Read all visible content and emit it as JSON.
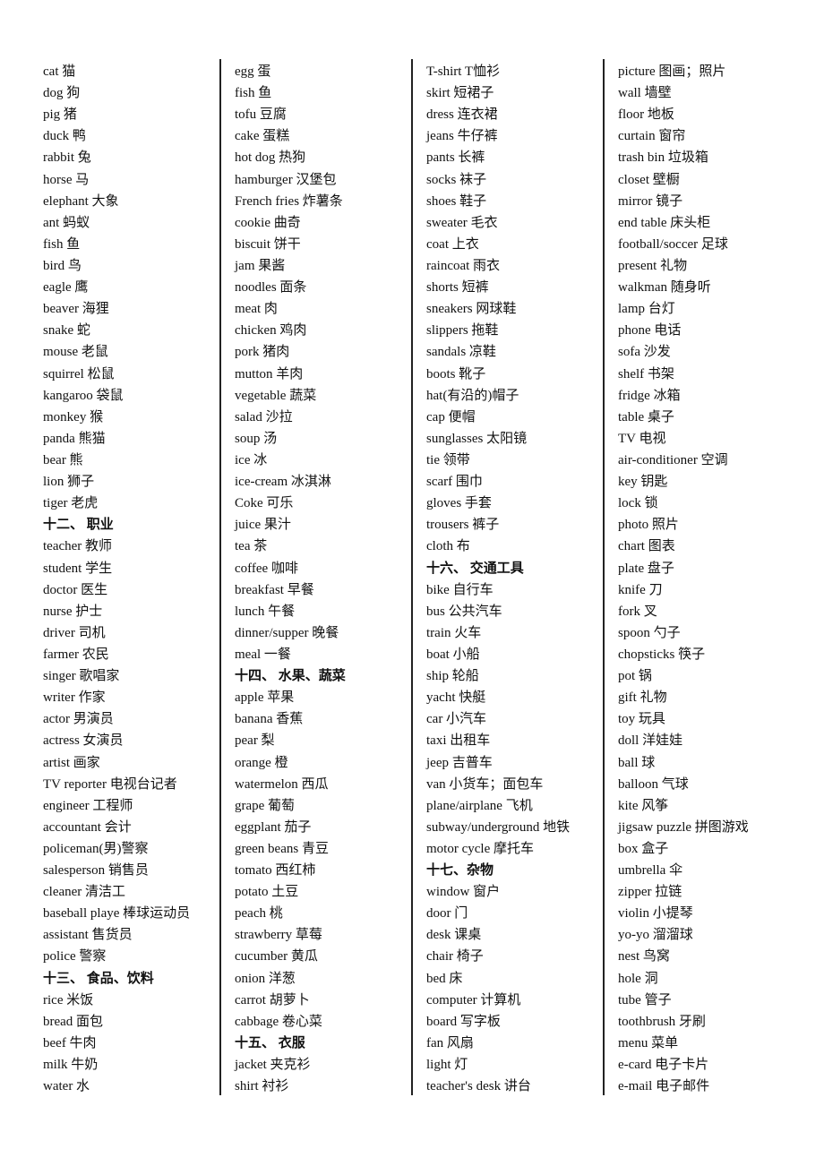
{
  "document": {
    "columns": [
      {
        "entries": [
          {
            "text": "cat 猫"
          },
          {
            "text": "dog 狗"
          },
          {
            "text": "pig 猪"
          },
          {
            "text": "duck 鸭"
          },
          {
            "text": "rabbit 兔"
          },
          {
            "text": "horse 马"
          },
          {
            "text": "elephant 大象"
          },
          {
            "text": "ant 蚂蚁"
          },
          {
            "text": "fish 鱼"
          },
          {
            "text": "bird 鸟"
          },
          {
            "text": "eagle 鹰"
          },
          {
            "text": "beaver 海狸"
          },
          {
            "text": "snake 蛇"
          },
          {
            "text": "mouse 老鼠"
          },
          {
            "text": "squirrel 松鼠"
          },
          {
            "text": "kangaroo 袋鼠"
          },
          {
            "text": "monkey 猴"
          },
          {
            "text": "panda 熊猫"
          },
          {
            "text": "bear 熊"
          },
          {
            "text": "lion 狮子"
          },
          {
            "text": "tiger  老虎"
          },
          {
            "text": "十二、  职业",
            "heading": true
          },
          {
            "text": "teacher 教师"
          },
          {
            "text": "student 学生"
          },
          {
            "text": "doctor 医生"
          },
          {
            "text": "nurse 护士"
          },
          {
            "text": "driver 司机"
          },
          {
            "text": "farmer 农民"
          },
          {
            "text": "singer 歌唱家"
          },
          {
            "text": "writer 作家"
          },
          {
            "text": "actor 男演员"
          },
          {
            "text": "actress 女演员"
          },
          {
            "text": "artist 画家"
          },
          {
            "text": "TV reporter 电视台记者"
          },
          {
            "text": "engineer 工程师"
          },
          {
            "text": "accountant 会计"
          },
          {
            "text": "policeman(男)警察"
          },
          {
            "text": "salesperson 销售员"
          },
          {
            "text": "cleaner 清洁工"
          },
          {
            "text": "baseball playe 棒球运动员"
          },
          {
            "text": "assistant 售货员"
          },
          {
            "text": "police 警察"
          },
          {
            "text": "十三、  食品、饮料",
            "heading": true
          },
          {
            "text": "rice 米饭"
          },
          {
            "text": "bread 面包"
          },
          {
            "text": "beef 牛肉"
          },
          {
            "text": "milk 牛奶"
          },
          {
            "text": "water 水"
          }
        ]
      },
      {
        "entries": [
          {
            "text": "egg 蛋"
          },
          {
            "text": "fish 鱼"
          },
          {
            "text": "tofu 豆腐"
          },
          {
            "text": "cake 蛋糕"
          },
          {
            "text": "hot dog 热狗"
          },
          {
            "text": "hamburger 汉堡包"
          },
          {
            "text": "French fries 炸薯条"
          },
          {
            "text": "cookie 曲奇"
          },
          {
            "text": "biscuit 饼干"
          },
          {
            "text": "jam 果酱"
          },
          {
            "text": "noodles 面条"
          },
          {
            "text": "meat 肉"
          },
          {
            "text": "chicken 鸡肉"
          },
          {
            "text": "pork 猪肉"
          },
          {
            "text": "mutton 羊肉"
          },
          {
            "text": "vegetable 蔬菜"
          },
          {
            "text": "salad 沙拉"
          },
          {
            "text": "soup 汤"
          },
          {
            "text": "ice 冰"
          },
          {
            "text": "ice-cream 冰淇淋"
          },
          {
            "text": "Coke 可乐"
          },
          {
            "text": "juice 果汁"
          },
          {
            "text": "tea 茶"
          },
          {
            "text": "coffee 咖啡"
          },
          {
            "text": "breakfast 早餐"
          },
          {
            "text": "lunch 午餐"
          },
          {
            "text": "dinner/supper 晚餐"
          },
          {
            "text": "meal 一餐"
          },
          {
            "text": "十四、  水果、蔬菜",
            "heading": true
          },
          {
            "text": "apple 苹果"
          },
          {
            "text": "banana 香蕉"
          },
          {
            "text": "pear 梨"
          },
          {
            "text": "orange 橙"
          },
          {
            "text": "watermelon 西瓜"
          },
          {
            "text": "grape 葡萄"
          },
          {
            "text": "eggplant 茄子"
          },
          {
            "text": "green beans 青豆"
          },
          {
            "text": "tomato 西红柿"
          },
          {
            "text": "potato 土豆"
          },
          {
            "text": "peach 桃"
          },
          {
            "text": "strawberry 草莓"
          },
          {
            "text": "cucumber 黄瓜"
          },
          {
            "text": "onion 洋葱"
          },
          {
            "text": "carrot 胡萝卜"
          },
          {
            "text": "cabbage 卷心菜"
          },
          {
            "text": "十五、  衣服",
            "heading": true
          },
          {
            "text": "jacket 夹克衫"
          },
          {
            "text": "shirt 衬衫"
          }
        ]
      },
      {
        "entries": [
          {
            "text": "T-shirt T恤衫"
          },
          {
            "text": "skirt 短裙子"
          },
          {
            "text": "dress 连衣裙"
          },
          {
            "text": "jeans 牛仔裤"
          },
          {
            "text": "pants 长裤"
          },
          {
            "text": "socks 袜子"
          },
          {
            "text": "shoes 鞋子"
          },
          {
            "text": "sweater 毛衣"
          },
          {
            "text": "coat 上衣"
          },
          {
            "text": "raincoat 雨衣"
          },
          {
            "text": "shorts 短裤"
          },
          {
            "text": "sneakers 网球鞋"
          },
          {
            "text": "slippers 拖鞋"
          },
          {
            "text": "sandals 凉鞋"
          },
          {
            "text": "boots 靴子"
          },
          {
            "text": "hat(有沿的)帽子"
          },
          {
            "text": "cap 便帽"
          },
          {
            "text": "sunglasses 太阳镜"
          },
          {
            "text": "tie 领带"
          },
          {
            "text": "scarf 围巾"
          },
          {
            "text": "gloves 手套"
          },
          {
            "text": "trousers 裤子"
          },
          {
            "text": "cloth 布"
          },
          {
            "text": "十六、  交通工具",
            "heading": true
          },
          {
            "text": "bike 自行车"
          },
          {
            "text": "bus 公共汽车"
          },
          {
            "text": "train 火车"
          },
          {
            "text": "boat 小船"
          },
          {
            "text": "ship 轮船"
          },
          {
            "text": "yacht 快艇"
          },
          {
            "text": "car 小汽车"
          },
          {
            "text": "taxi 出租车"
          },
          {
            "text": "jeep 吉普车"
          },
          {
            "text": "van 小货车；面包车"
          },
          {
            "text": "plane/airplane 飞机"
          },
          {
            "text": "subway/underground 地铁"
          },
          {
            "text": "motor cycle 摩托车"
          },
          {
            "text": "十七、杂物",
            "heading": true
          },
          {
            "text": "window 窗户"
          },
          {
            "text": "door 门"
          },
          {
            "text": "desk 课桌"
          },
          {
            "text": "chair 椅子"
          },
          {
            "text": "bed 床"
          },
          {
            "text": "computer 计算机"
          },
          {
            "text": "board 写字板"
          },
          {
            "text": "fan 风扇"
          },
          {
            "text": "light 灯"
          },
          {
            "text": "teacher's desk 讲台"
          }
        ]
      },
      {
        "entries": [
          {
            "text": "picture 图画；照片"
          },
          {
            "text": "wall 墙壁"
          },
          {
            "text": "floor 地板"
          },
          {
            "text": "curtain 窗帘"
          },
          {
            "text": "trash bin 垃圾箱"
          },
          {
            "text": "closet 壁橱"
          },
          {
            "text": "mirror 镜子"
          },
          {
            "text": "end table 床头柜"
          },
          {
            "text": "football/soccer 足球"
          },
          {
            "text": "present 礼物"
          },
          {
            "text": "walkman 随身听"
          },
          {
            "text": "lamp 台灯"
          },
          {
            "text": "phone 电话"
          },
          {
            "text": "sofa 沙发"
          },
          {
            "text": "shelf 书架"
          },
          {
            "text": "fridge 冰箱"
          },
          {
            "text": "table 桌子"
          },
          {
            "text": "TV 电视"
          },
          {
            "text": "air-conditioner 空调"
          },
          {
            "text": "key 钥匙"
          },
          {
            "text": "lock 锁"
          },
          {
            "text": "photo 照片"
          },
          {
            "text": "chart 图表"
          },
          {
            "text": "plate 盘子"
          },
          {
            "text": "knife 刀"
          },
          {
            "text": "fork 叉"
          },
          {
            "text": "spoon 勺子"
          },
          {
            "text": "chopsticks 筷子"
          },
          {
            "text": "pot 锅"
          },
          {
            "text": "gift 礼物"
          },
          {
            "text": "toy 玩具"
          },
          {
            "text": "doll 洋娃娃"
          },
          {
            "text": "ball 球"
          },
          {
            "text": "balloon 气球"
          },
          {
            "text": "kite 风筝"
          },
          {
            "text": "jigsaw puzzle 拼图游戏"
          },
          {
            "text": "box 盒子"
          },
          {
            "text": "umbrella 伞"
          },
          {
            "text": "zipper 拉链"
          },
          {
            "text": "violin 小提琴"
          },
          {
            "text": "yo-yo 溜溜球"
          },
          {
            "text": "nest 鸟窝"
          },
          {
            "text": "hole 洞"
          },
          {
            "text": "tube 管子"
          },
          {
            "text": "toothbrush 牙刷"
          },
          {
            "text": "menu 菜单"
          },
          {
            "text": "e-card 电子卡片"
          },
          {
            "text": "e-mail 电子邮件"
          }
        ]
      }
    ]
  }
}
